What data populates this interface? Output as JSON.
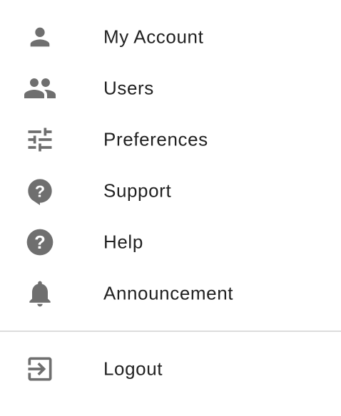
{
  "menu": {
    "items": [
      {
        "label": "My Account",
        "icon": "person-icon"
      },
      {
        "label": "Users",
        "icon": "people-icon"
      },
      {
        "label": "Preferences",
        "icon": "tune-icon"
      },
      {
        "label": "Support",
        "icon": "support-question-bubble-icon"
      },
      {
        "label": "Help",
        "icon": "help-circle-icon"
      },
      {
        "label": "Announcement",
        "icon": "bell-icon"
      }
    ],
    "logout": {
      "label": "Logout",
      "icon": "logout-exit-icon"
    }
  },
  "colors": {
    "icon": "#6f6f6f",
    "text": "#212121",
    "divider": "#dcdcdc",
    "background": "#ffffff"
  }
}
